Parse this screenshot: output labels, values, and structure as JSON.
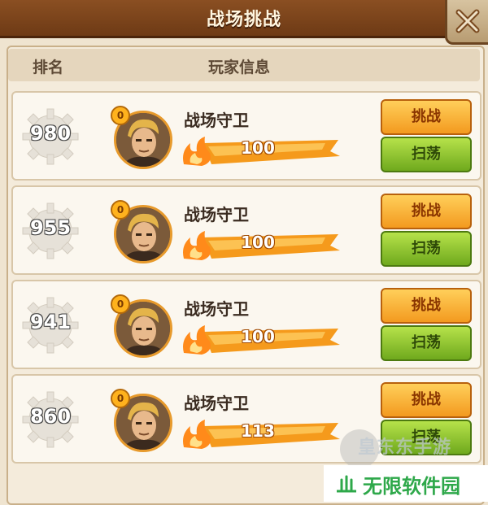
{
  "title": "战场挑战",
  "header": {
    "rank_label": "排名",
    "info_label": "玩家信息"
  },
  "rows": [
    {
      "rank": "980",
      "level": "0",
      "name": "战场守卫",
      "power": "100",
      "challenge_label": "挑战",
      "sweep_label": "扫荡"
    },
    {
      "rank": "955",
      "level": "0",
      "name": "战场守卫",
      "power": "100",
      "challenge_label": "挑战",
      "sweep_label": "扫荡"
    },
    {
      "rank": "941",
      "level": "0",
      "name": "战场守卫",
      "power": "100",
      "challenge_label": "挑战",
      "sweep_label": "扫荡"
    },
    {
      "rank": "860",
      "level": "0",
      "name": "战场守卫",
      "power": "113",
      "challenge_label": "挑战",
      "sweep_label": "扫荡"
    }
  ],
  "watermark": {
    "site_faint": "皇东东手游",
    "site": "无限软件园"
  },
  "colors": {
    "title_bar": "#7a4419",
    "challenge": "#f7a82a",
    "sweep": "#8cc12a",
    "power": "#f59a1c"
  }
}
